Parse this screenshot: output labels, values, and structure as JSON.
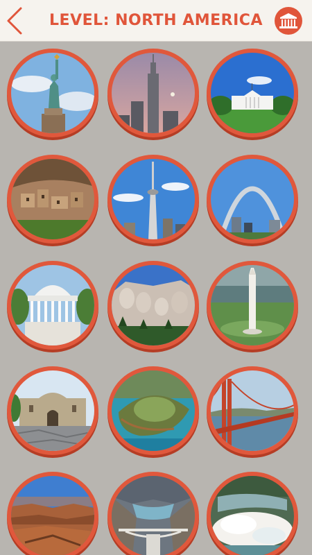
{
  "header": {
    "title": "LEVEL: NORTH AMERICA",
    "back_icon": "chevron-left-icon",
    "museum_icon": "museum-icon"
  },
  "colors": {
    "accent": "#e0553a",
    "header_bg": "#f6f3ee",
    "page_bg": "#b8b5b0"
  },
  "levels": [
    {
      "landmark": "statue-of-liberty"
    },
    {
      "landmark": "empire-state-building"
    },
    {
      "landmark": "white-house"
    },
    {
      "landmark": "mesa-verde-cliff-palace"
    },
    {
      "landmark": "cn-tower"
    },
    {
      "landmark": "gateway-arch"
    },
    {
      "landmark": "jefferson-memorial"
    },
    {
      "landmark": "mount-rushmore"
    },
    {
      "landmark": "washington-monument"
    },
    {
      "landmark": "the-alamo"
    },
    {
      "landmark": "diamond-head"
    },
    {
      "landmark": "golden-gate-bridge"
    },
    {
      "landmark": "grand-canyon"
    },
    {
      "landmark": "hoover-dam"
    },
    {
      "landmark": "niagara-falls"
    }
  ]
}
